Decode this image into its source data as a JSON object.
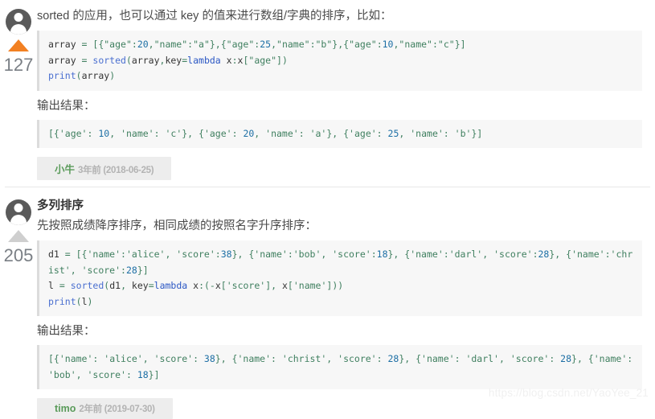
{
  "watermark": "https://blog.csdn.net/YaoYee_21",
  "answers": [
    {
      "id": "answer-1",
      "votes": "127",
      "vote_arrow_color": "#f28022",
      "title": "",
      "intro": "sorted 的应用，也可以通过 key 的值来进行数组/字典的排序，比如：",
      "code": "array = [{\"age\":20,\"name\":\"a\"},{\"age\":25,\"name\":\"b\"},{\"age\":10,\"name\":\"c\"}]\narray = sorted(array,key=lambda x:x[\"age\"])\nprint(array)",
      "output_label": "输出结果：",
      "output": "[{'age': 10, 'name': 'c'}, {'age': 20, 'name': 'a'}, {'age': 25, 'name': 'b'}]",
      "sig_user": "小牛",
      "sig_time": "3年前 (2018-06-25)"
    },
    {
      "id": "answer-2",
      "votes": "205",
      "vote_arrow_color": "#cfcfcf",
      "title": "多列排序",
      "intro": "先按照成绩降序排序，相同成绩的按照名字升序排序：",
      "code": "d1 = [{'name':'alice', 'score':38}, {'name':'bob', 'score':18}, {'name':'darl', 'score':28}, {'name':'christ', 'score':28}]\nl = sorted(d1, key=lambda x:(-x['score'], x['name']))\nprint(l)",
      "output_label": "输出结果：",
      "output": "[{'name': 'alice', 'score': 38}, {'name': 'christ', 'score': 28}, {'name': 'darl', 'score': 28}, {'name': 'bob', 'score': 18}]",
      "sig_user": "timo",
      "sig_time": "2年前 (2019-07-30)"
    }
  ]
}
